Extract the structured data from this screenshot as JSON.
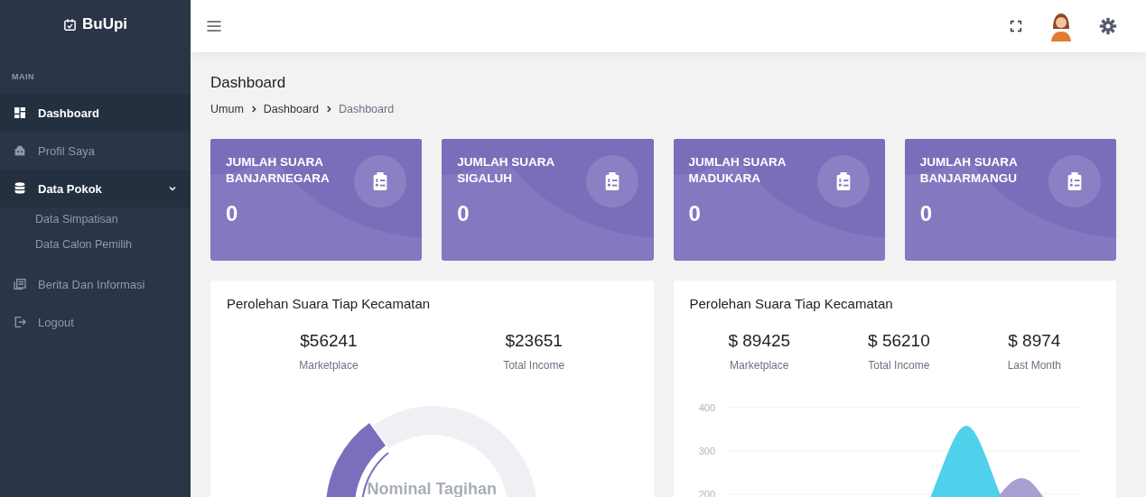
{
  "brand": {
    "name": "BuUpi"
  },
  "sidebar": {
    "section": "MAIN",
    "items": [
      {
        "label": "Dashboard",
        "kind": "link",
        "selected": true
      },
      {
        "label": "Profil Saya",
        "kind": "link",
        "selected": false
      },
      {
        "label": "Data Pokok",
        "kind": "group",
        "selected": true,
        "expanded": true,
        "children": [
          {
            "label": "Data Simpatisan",
            "selected": false
          },
          {
            "label": "Data Calon Pemilih",
            "selected": false
          }
        ]
      },
      {
        "label": "Berita Dan Informasi",
        "kind": "link",
        "selected": false
      },
      {
        "label": "Logout",
        "kind": "link",
        "selected": false
      }
    ]
  },
  "page": {
    "title": "Dashboard",
    "breadcrumb": [
      "Umum",
      "Dashboard",
      "Dashboard"
    ]
  },
  "stat_cards": [
    {
      "title": "JUMLAH SUARA BANJARNEGARA",
      "value": "0"
    },
    {
      "title": "JUMLAH SUARA SIGALUH",
      "value": "0"
    },
    {
      "title": "JUMLAH SUARA MADUKARA",
      "value": "0"
    },
    {
      "title": "JUMLAH SUARA BANJARMANGU",
      "value": "0"
    }
  ],
  "panels": [
    {
      "title": "Perolehan Suara Tiap Kecamatan",
      "kind": "donut",
      "stats": [
        {
          "value": "$56241",
          "label": "Marketplace"
        },
        {
          "value": "$23651",
          "label": "Total Income"
        }
      ],
      "center_label": "Nominal Tagihan"
    },
    {
      "title": "Perolehan Suara Tiap Kecamatan",
      "kind": "area",
      "stats": [
        {
          "value": "$ 89425",
          "label": "Marketplace"
        },
        {
          "value": "$ 56210",
          "label": "Total Income"
        },
        {
          "value": "$ 8974",
          "label": "Last Month"
        }
      ],
      "axis_labels": [
        "400",
        "300",
        "200"
      ]
    }
  ]
}
